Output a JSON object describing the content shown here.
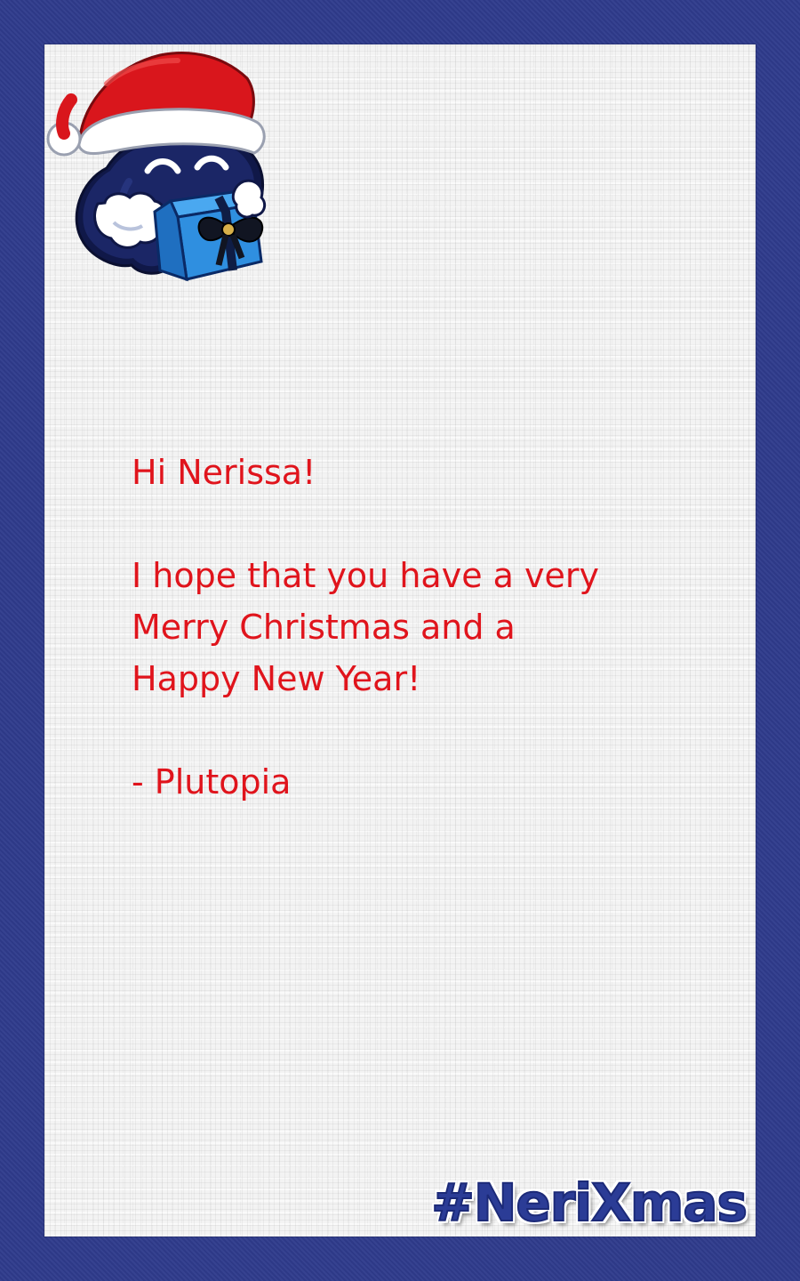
{
  "card": {
    "greeting": "Hi Nerissa!",
    "body_lines": [
      "I hope that you have a very",
      "Merry Christmas and a",
      "Happy New Year!"
    ],
    "signature": "- Plutopia",
    "hashtag": "#NeriXmas"
  },
  "mascot": {
    "icon": "santa-hat-blob-holding-gift",
    "hat_color": "#d9161c",
    "body_color": "#16205a",
    "gift_color": "#2f8fe0"
  },
  "colors": {
    "frame": "#2f3b8c",
    "paper": "#f3f3f3",
    "message_text": "#e0141c",
    "hashtag_fill": "#2b3c96"
  }
}
